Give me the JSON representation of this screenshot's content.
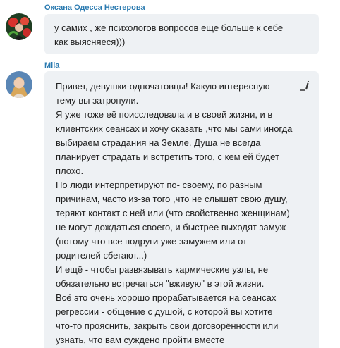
{
  "posts": [
    {
      "author": "Оксана Одесса Нестерова",
      "avatar_icon": "user-avatar-woman-flowers",
      "lines": [
        "у самих , же психологов вопросов еще больше к себе",
        "как выясняеся)))"
      ]
    },
    {
      "author": "Mila",
      "avatar_icon": "user-avatar-woman-blonde",
      "action_icon": "edit-pencil-icon",
      "lines": [
        "Привет, девушки-одночатовцы! Какую интересную",
        "тему вы затронули.",
        "Я уже тоже её поисследовала и в своей жизни, и в",
        "клиентских сеансах и хочу сказать ,что мы сами иногда",
        "выбираем страдания на Земле. Душа не всегда",
        "планирует страдать и встретить того, с кем ей будет",
        "плохо.",
        "Но люди интерпретируют по- своему, по разным",
        "причинам, часто из-за того ,что не слышат свою душу,",
        "теряют контакт с ней или (что свойственно женщинам)",
        "не могут дождаться своего, и быстрее выходят замуж",
        "(потому что все подруги уже замужем или от",
        "родителей сбегают...)",
        "И ещё - чтобы развязывать кармические узлы, не",
        "обязательно встречаться \"вживую\" в этой жизни.",
        "Всё это очень хорошо прорабатывается на сеансах",
        "регрессии - общение с душой, с которой вы хотите",
        "что-то прояснить, закрыть свои договорённости или",
        "узнать, что вам суждено пройти вместе"
      ]
    }
  ],
  "colors": {
    "author": "#2a7ab0",
    "bubble": "#eef1f4",
    "text": "#222222"
  }
}
